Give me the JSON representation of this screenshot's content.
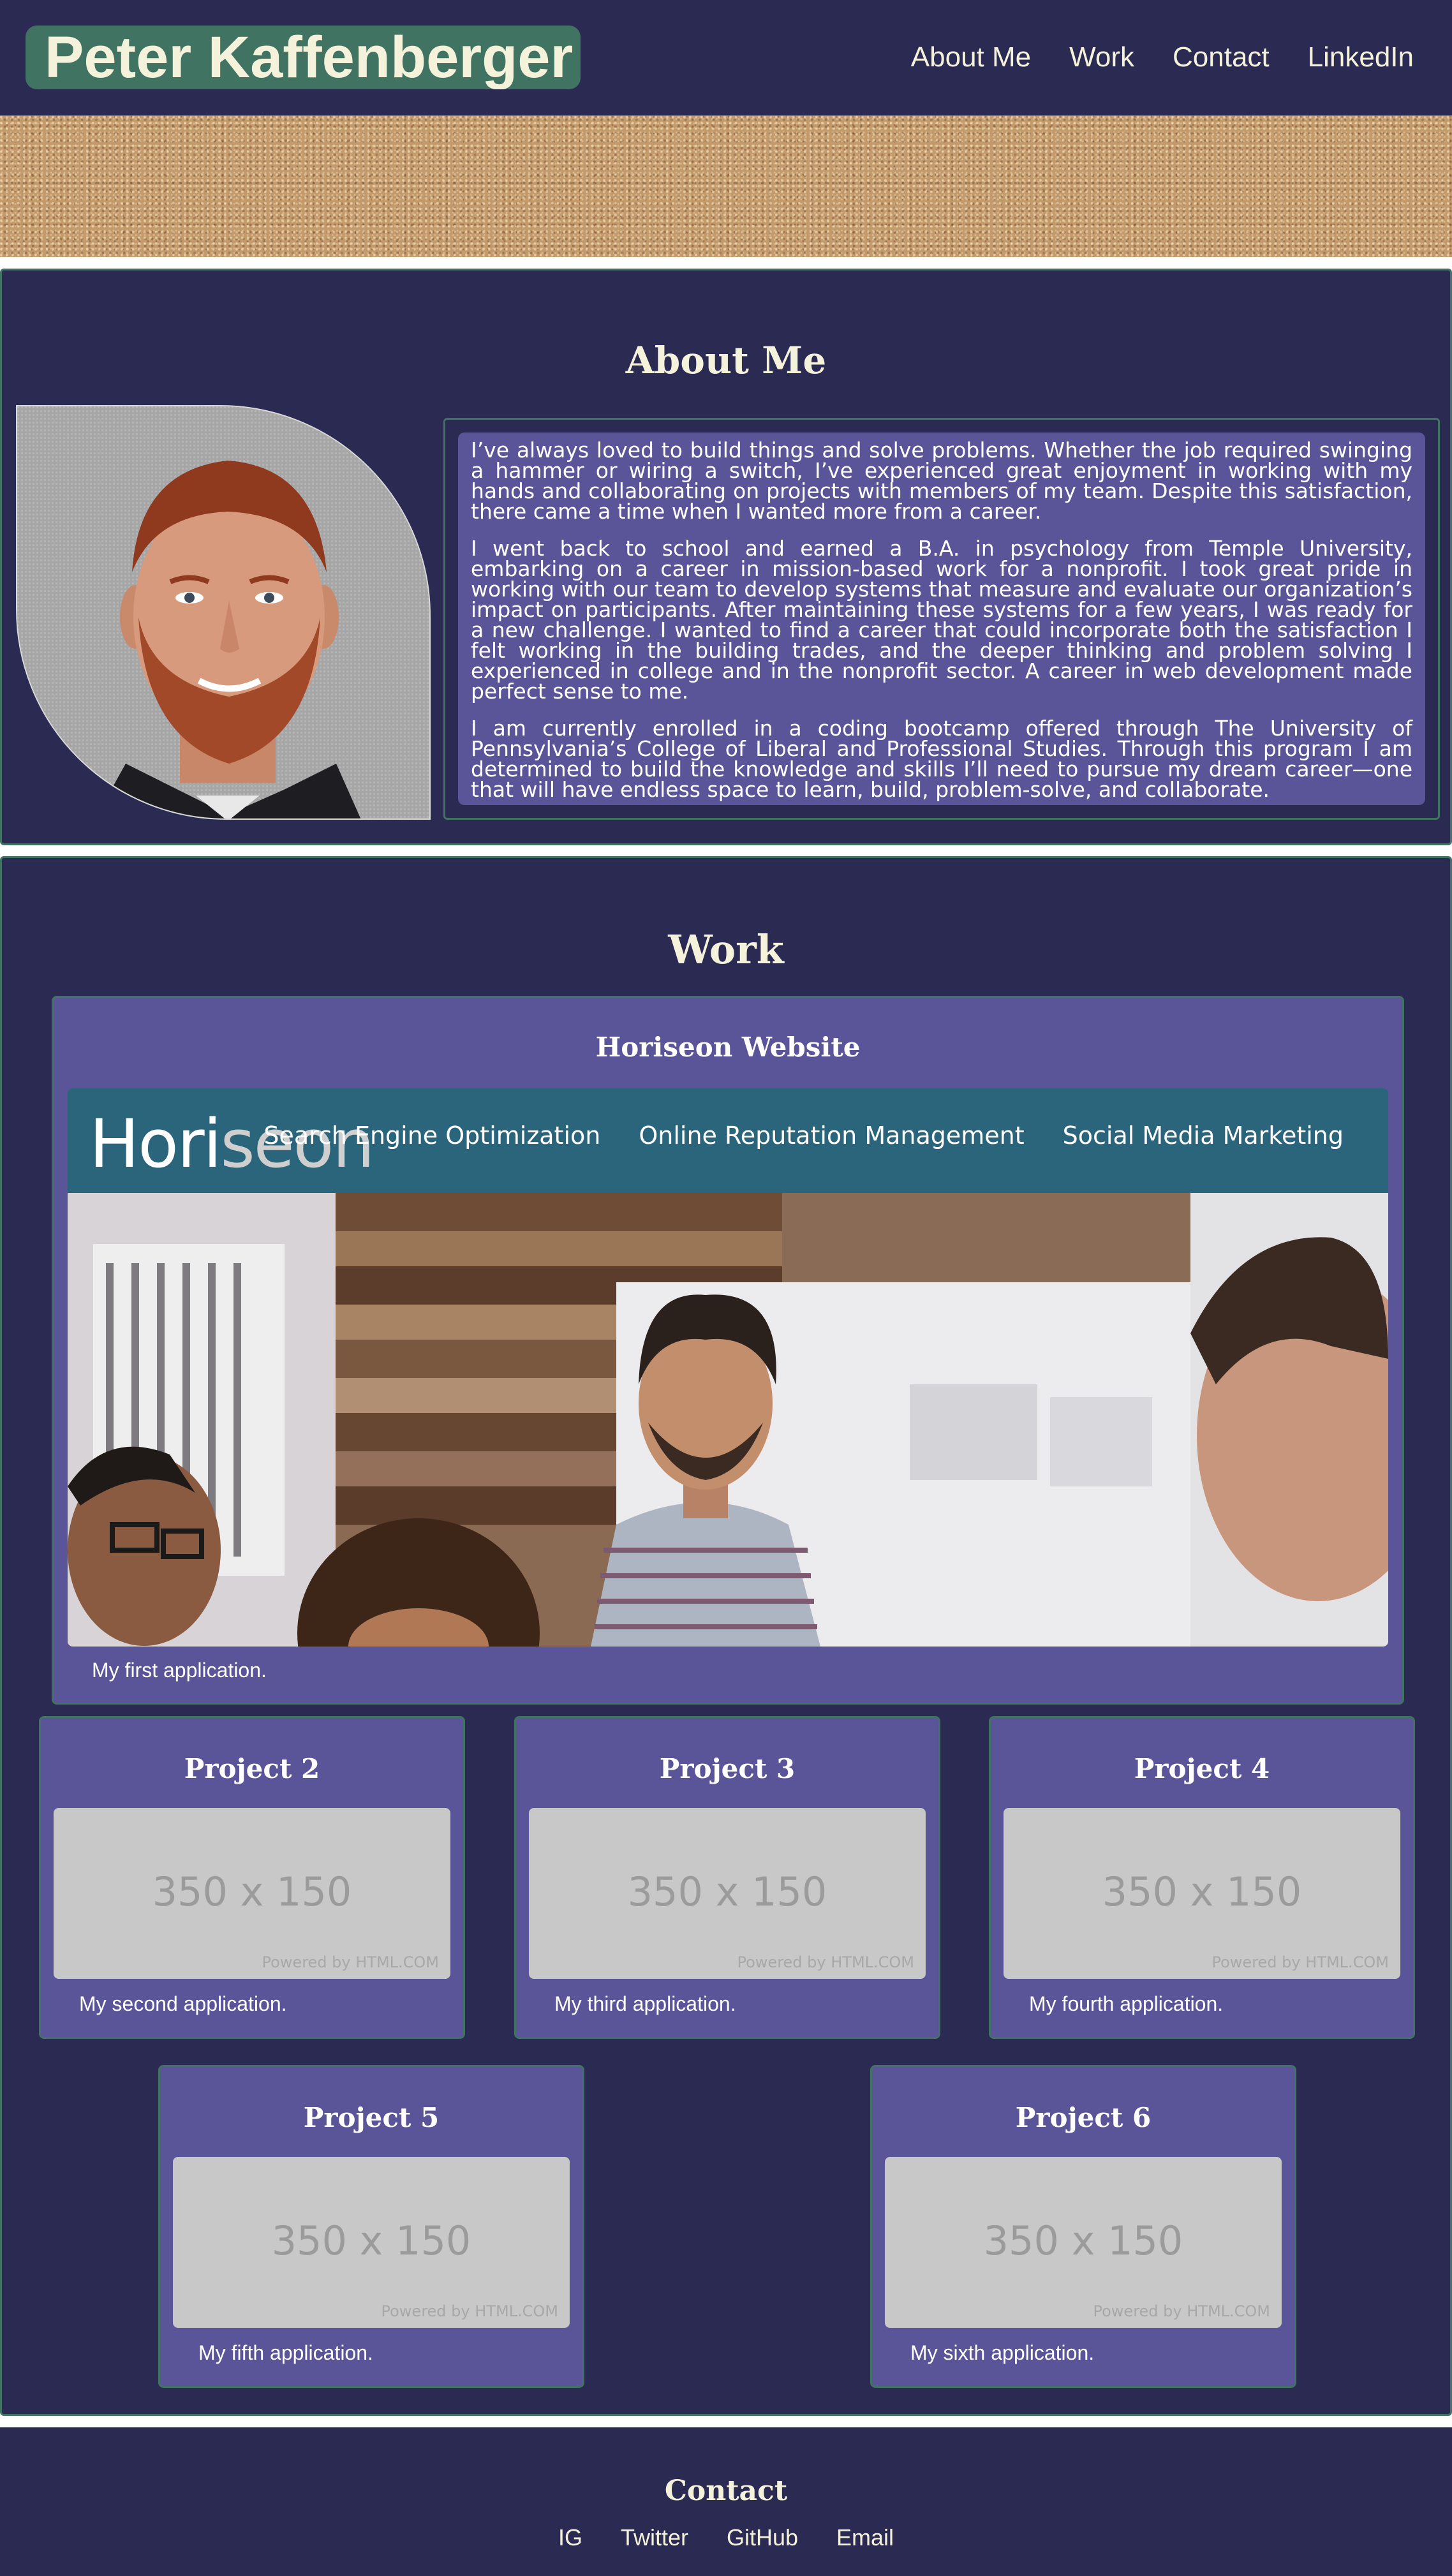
{
  "header": {
    "title": "Peter Kaffenberger",
    "nav": [
      "About Me",
      "Work",
      "Contact",
      "LinkedIn"
    ]
  },
  "about": {
    "title": "About Me",
    "paragraphs": [
      "I’ve always loved to build things and solve problems. Whether the job required swinging a hammer or wiring a switch, I’ve experienced great enjoyment in working with my hands and collaborating on projects with members of my team. Despite this satisfaction, there came a time when I wanted more from a career.",
      "I went back to school and earned a B.A. in psychology from Temple University, embarking on a career in mission-based work for a nonprofit. I took great pride in working with our team to develop systems that measure and evaluate our organization’s impact on participants. After maintaining these systems for a few years, I was ready for a new challenge. I wanted to find a career that could incorporate both the satisfaction I felt working in the building trades, and the deeper thinking and problem solving I experienced in college and in the nonprofit sector. A career in web development made perfect sense to me.",
      "I am currently enrolled in a coding bootcamp offered through The University of Pennsylvania’s College of Liberal and Professional Studies. Through this program I am determined to build the knowledge and skills I’ll need to pursue my dream career—one that will have endless space to learn, build, problem-solve, and collaborate."
    ]
  },
  "work": {
    "title": "Work",
    "featured": {
      "title": "Horiseon Website",
      "caption": "My first application.",
      "screenshot": {
        "logo_a": "Hori",
        "logo_b": "seon",
        "links": [
          "Search Engine Optimization",
          "Online Reputation Management",
          "Social Media Marketing"
        ]
      }
    },
    "projects": [
      {
        "title": "Project 2",
        "caption": "My second application.",
        "placeholder": "350 x 150",
        "powered": "Powered by HTML.COM"
      },
      {
        "title": "Project 3",
        "caption": "My third application.",
        "placeholder": "350 x 150",
        "powered": "Powered by HTML.COM"
      },
      {
        "title": "Project 4",
        "caption": "My fourth application.",
        "placeholder": "350 x 150",
        "powered": "Powered by HTML.COM"
      },
      {
        "title": "Project 5",
        "caption": "My fifth application.",
        "placeholder": "350 x 150",
        "powered": "Powered by HTML.COM"
      },
      {
        "title": "Project 6",
        "caption": "My sixth application.",
        "placeholder": "350 x 150",
        "powered": "Powered by HTML.COM"
      }
    ]
  },
  "contact": {
    "title": "Contact",
    "links": [
      "IG",
      "Twitter",
      "GitHub",
      "Email"
    ]
  },
  "colors": {
    "navy": "#2b2a52",
    "green": "#417363",
    "purple": "#5a5498",
    "cream": "#f5f2dc",
    "horiseon_teal": "#2a657c"
  }
}
